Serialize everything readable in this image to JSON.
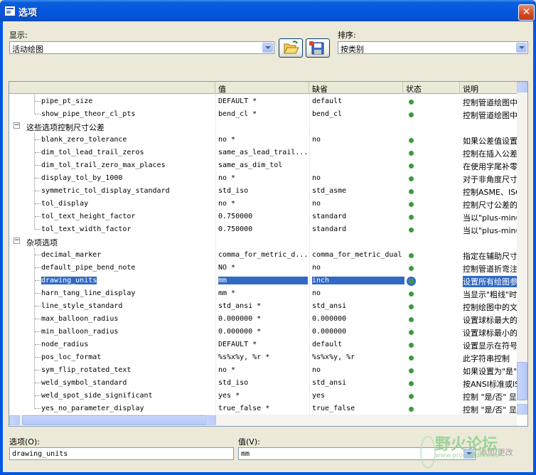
{
  "window": {
    "title": "选项",
    "close_glyph": "✕"
  },
  "display": {
    "label": "显示:",
    "value": "活动绘图"
  },
  "sort": {
    "label": "排序:",
    "value": "按类别"
  },
  "columns": [
    "值",
    "缺省",
    "状态",
    "说明"
  ],
  "rows": [
    {
      "kind": "item",
      "name": "pipe_pt_size",
      "value": "DEFAULT *",
      "default": "default",
      "desc": "控制管道绘图中"
    },
    {
      "kind": "item",
      "name": "show_pipe_theor_cl_pts",
      "value": "bend_cl *",
      "default": "bend_cl",
      "desc": "控制管道绘图中"
    },
    {
      "kind": "group",
      "name": "这些选项控制尺寸公差"
    },
    {
      "kind": "item",
      "name": "blank_zero_tolerance",
      "value": "no *",
      "default": "no",
      "desc": "如果公差值设置"
    },
    {
      "kind": "item",
      "name": "dim_tol_lead_trail_zeros",
      "value": "same_as_lead_trail...",
      "default": "",
      "desc": "控制在插入公差"
    },
    {
      "kind": "item",
      "name": "dim_tol_trail_zero_max_places",
      "value": "same_as_dim_tol",
      "default": "",
      "desc": "在使用字尾补零"
    },
    {
      "kind": "item",
      "name": "display_tol_by_1000",
      "value": "no *",
      "default": "no",
      "desc": "对于非角度尺寸"
    },
    {
      "kind": "item",
      "name": "symmetric_tol_display_standard",
      "value": "std_iso",
      "default": "std_asme",
      "desc": "控制ASME、ISO"
    },
    {
      "kind": "item",
      "name": "tol_display",
      "value": "no *",
      "default": "no",
      "desc": "控制尺寸公差的"
    },
    {
      "kind": "item",
      "name": "tol_text_height_factor",
      "value": "0.750000",
      "default": "standard",
      "desc": "当以\"plus-minu"
    },
    {
      "kind": "item",
      "name": "tol_text_width_factor",
      "value": "0.750000",
      "default": "standard",
      "desc": "当以\"plus-minu"
    },
    {
      "kind": "group",
      "name": "杂项选项"
    },
    {
      "kind": "item",
      "name": "decimal_marker",
      "value": "comma_for_metric_d...",
      "default": "comma_for_metric_dual",
      "desc": "指定在辅助尺寸"
    },
    {
      "kind": "item",
      "name": "default_pipe_bend_note",
      "value": "NO *",
      "default": "no",
      "desc": "控制管道折弯注"
    },
    {
      "kind": "item",
      "name": "drawing_units",
      "value": "mm",
      "default": "inch",
      "desc": "设置所有绘图参",
      "selected": true
    },
    {
      "kind": "item",
      "name": "harn_tang_line_display",
      "value": "mm *",
      "default": "no",
      "desc": "当显示\"粗线\"时"
    },
    {
      "kind": "item",
      "name": "line_style_standard",
      "value": "std_ansi *",
      "default": "std_ansi",
      "desc": "控制绘图中的文"
    },
    {
      "kind": "item",
      "name": "max_balloon_radius",
      "value": "0.000000 *",
      "default": "0.000000",
      "desc": "设置球标最大的"
    },
    {
      "kind": "item",
      "name": "min_balloon_radius",
      "value": "0.000000 *",
      "default": "0.000000",
      "desc": "设置球标最小的"
    },
    {
      "kind": "item",
      "name": "node_radius",
      "value": "DEFAULT *",
      "default": "default",
      "desc": "设置显示在符号"
    },
    {
      "kind": "item",
      "name": "pos_loc_format",
      "value": "%s%x%y, %r *",
      "default": "%s%x%y, %r",
      "desc": "此字符串控制"
    },
    {
      "kind": "item",
      "name": "sym_flip_rotated_text",
      "value": "no *",
      "default": "no",
      "desc": "如果设置为\"是\""
    },
    {
      "kind": "item",
      "name": "weld_symbol_standard",
      "value": "std_iso",
      "default": "std_ansi",
      "desc": "按ANSI标准或IS"
    },
    {
      "kind": "item",
      "name": "weld_spot_side_significant",
      "value": "yes *",
      "default": "yes",
      "desc": "控制 \"是/否\" 显"
    },
    {
      "kind": "item",
      "name": "yes_no_parameter_display",
      "value": "true_false *",
      "default": "true_false",
      "desc": "控制 \"是/否\" 显"
    }
  ],
  "option": {
    "label": "选项(O):",
    "value": "drawing_units"
  },
  "value_field": {
    "label": "值(V):",
    "value": "mm"
  },
  "add_change": "添加/更改",
  "watermark": {
    "text": "野火论坛",
    "url": "www.proewildfire.cn"
  },
  "colors": {
    "title_bar": "#0456e0",
    "selection": "#316ac5",
    "status_dot": "#3c9a3c",
    "face": "#ece9d8"
  }
}
